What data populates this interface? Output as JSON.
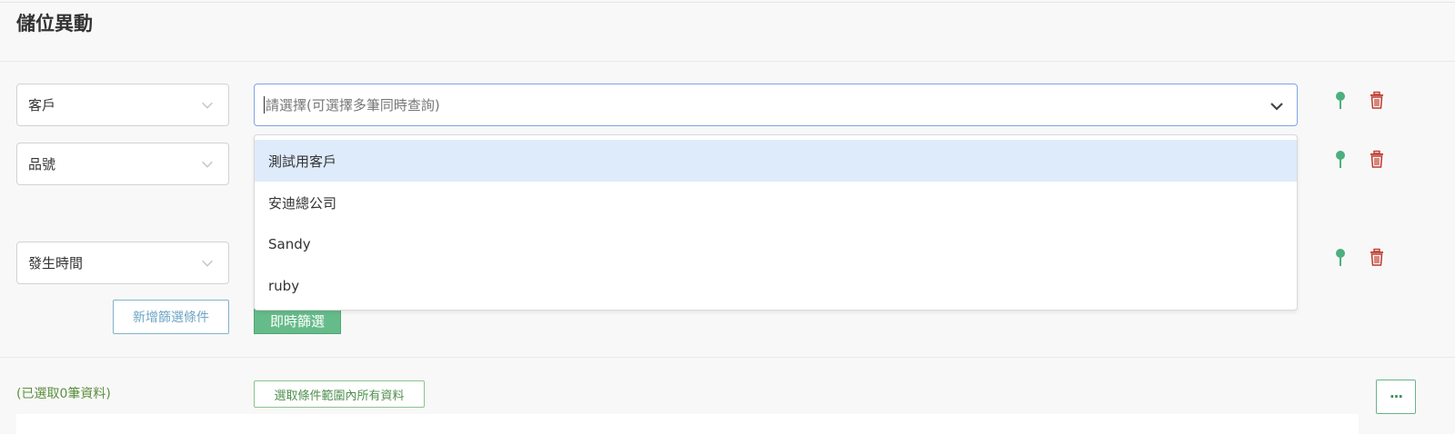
{
  "page": {
    "title": "儲位異動"
  },
  "filters": [
    {
      "field": "客戶"
    },
    {
      "field": "品號"
    },
    {
      "field": "發生時間"
    }
  ],
  "customer_select": {
    "placeholder": "請選擇(可選擇多筆同時查詢)",
    "options": [
      "測試用客戶",
      "安迪總公司",
      "Sandy",
      "ruby"
    ],
    "highlighted_option": "測試用客戶"
  },
  "actions": {
    "add_filter_label": "新增篩選條件",
    "instant_filter_label": "即時篩選",
    "select_all_label": "選取條件範圍內所有資料",
    "more_label": "···"
  },
  "status": {
    "selected_count_text": "(已選取0筆資料)"
  },
  "icons": {
    "pin": "pin-icon",
    "delete": "trash-icon",
    "dropdown": "chevron-down-icon"
  },
  "colors": {
    "pin": "#4caf7d",
    "delete": "#c0392b",
    "primary_green": "#66bb8a",
    "focus_border": "#7fa4e6",
    "highlight": "#deebfb",
    "count_text": "#5c8f3f"
  }
}
